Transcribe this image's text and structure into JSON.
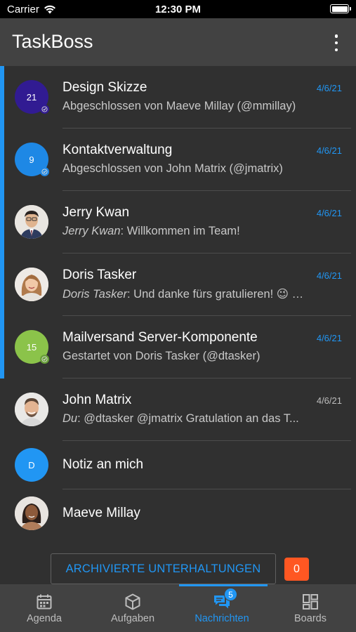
{
  "status_bar": {
    "carrier": "Carrier",
    "time": "12:30 PM"
  },
  "app_bar": {
    "title": "TaskBoss"
  },
  "conversations": [
    {
      "type": "number",
      "avatar_text": "21",
      "avatar_color": "#311b92",
      "badge_color": "#311b92",
      "unread": true,
      "name": "Design Skizze",
      "date": "4/6/21",
      "sub_prefix": "",
      "sub_text": "Abgeschlossen von Maeve Millay (@mmillay)"
    },
    {
      "type": "number",
      "avatar_text": "9",
      "avatar_color": "#1e88e5",
      "badge_color": "#1e88e5",
      "unread": true,
      "name": "Kontaktverwaltung",
      "date": "4/6/21",
      "sub_prefix": "",
      "sub_text": "Abgeschlossen von John Matrix (@jmatrix)"
    },
    {
      "type": "photo",
      "avatar_icon": "person-photo-jerry",
      "unread": true,
      "name": "Jerry Kwan",
      "date": "4/6/21",
      "sub_prefix": "Jerry Kwan",
      "sub_text": ": Willkommen im Team!"
    },
    {
      "type": "photo",
      "avatar_icon": "person-photo-doris",
      "unread": true,
      "name": "Doris Tasker",
      "date": "4/6/21",
      "sub_prefix": "Doris Tasker",
      "sub_text": ": Und danke fürs gratulieren! 😉 …"
    },
    {
      "type": "number",
      "avatar_text": "15",
      "avatar_color": "#8bc34a",
      "badge_color": "#689f38",
      "unread": true,
      "name": "Mailversand Server-Komponente",
      "date": "4/6/21",
      "sub_prefix": "",
      "sub_text": "Gestartet von Doris Tasker (@dtasker)"
    },
    {
      "type": "photo",
      "avatar_icon": "person-photo-john",
      "unread": false,
      "name": "John Matrix",
      "date": "4/6/21",
      "sub_prefix": "Du",
      "sub_text": ": @dtasker @jmatrix Gratulation an das T..."
    },
    {
      "type": "letter",
      "avatar_text": "D",
      "avatar_color": "#2196f3",
      "unread": false,
      "name": "Notiz an mich"
    },
    {
      "type": "photo",
      "avatar_icon": "person-photo-maeve",
      "unread": false,
      "name": "Maeve Millay"
    }
  ],
  "archive": {
    "label": "ARCHIVIERTE UNTERHALTUNGEN",
    "count": "0"
  },
  "tabs": [
    {
      "label": "Agenda",
      "icon": "calendar-icon",
      "active": false
    },
    {
      "label": "Aufgaben",
      "icon": "box-icon",
      "active": false
    },
    {
      "label": "Nachrichten",
      "icon": "chat-icon",
      "active": true,
      "badge": "5"
    },
    {
      "label": "Boards",
      "icon": "grid-icon",
      "active": false
    }
  ],
  "colors": {
    "accent": "#2196f3",
    "background": "#303030",
    "bar": "#424242",
    "archive_badge": "#ff5722"
  }
}
